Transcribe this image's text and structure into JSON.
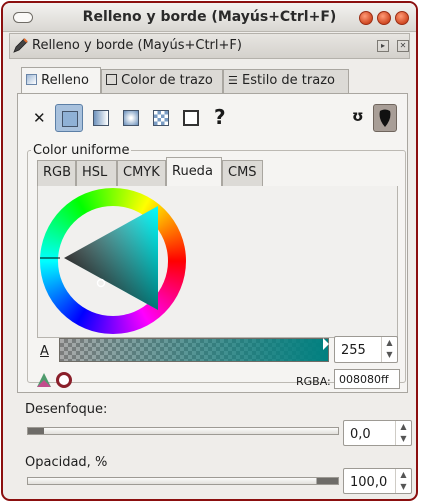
{
  "window": {
    "title": "Relleno y borde (Mayús+Ctrl+F)"
  },
  "dock": {
    "title": "Relleno y borde (Mayús+Ctrl+F)"
  },
  "tabs": [
    {
      "label": "Relleno",
      "icon": "fill-swatch-icon"
    },
    {
      "label": "Color de trazo",
      "icon": "stroke-swatch-icon"
    },
    {
      "label": "Estilo de trazo",
      "icon": "stroke-style-icon"
    }
  ],
  "fill_types": [
    {
      "name": "no-paint",
      "glyph": "✕"
    },
    {
      "name": "flat-color"
    },
    {
      "name": "linear-gradient"
    },
    {
      "name": "radial-gradient"
    },
    {
      "name": "pattern"
    },
    {
      "name": "swatch"
    },
    {
      "name": "unset",
      "glyph": "?"
    }
  ],
  "fill_rule": {
    "evenodd_glyph": "ʊ"
  },
  "color_group": {
    "label": "Color uniforme"
  },
  "color_tabs": [
    "RGB",
    "HSL",
    "CMYK",
    "Rueda",
    "CMS"
  ],
  "color_tabs_active": "Rueda",
  "alpha": {
    "label": "A",
    "value": "255"
  },
  "rgba": {
    "label": "RGBA:",
    "value": "008080ff"
  },
  "blur": {
    "label": "Desenfoque:",
    "value": "0,0",
    "fraction": 0.05
  },
  "opacity": {
    "label": "Opacidad, %",
    "value": "100,0",
    "fraction": 1.0
  },
  "colors": {
    "current": "#008080",
    "window_border": "#8b0f0f",
    "active_tab": "#a8c1dd"
  }
}
